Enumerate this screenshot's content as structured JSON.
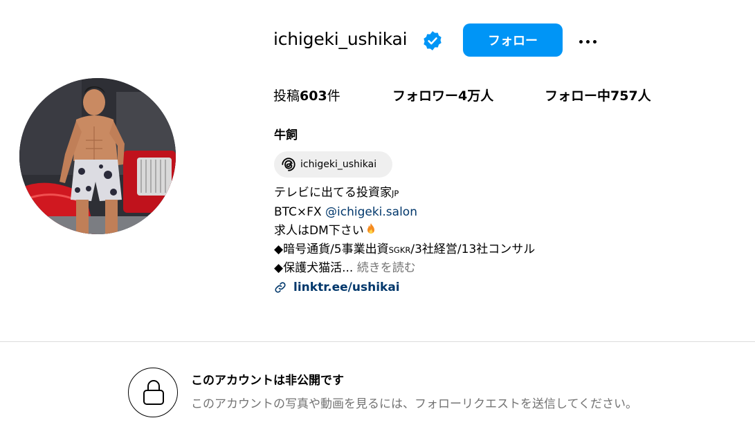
{
  "profile": {
    "username": "ichigeki_ushikai",
    "verified": true,
    "follow_label": "フォロー",
    "full_name": "牛飼",
    "threads_handle": "ichigeki_ushikai"
  },
  "stats": {
    "posts_label": "投稿",
    "posts_count": "603",
    "posts_unit": "件",
    "followers": "フォロワー4万人",
    "following": "フォロー中757人"
  },
  "bio": {
    "line1": "テレビに出てる投資家",
    "line1_suffix": "JP",
    "line2_prefix": "BTC×FX ",
    "line2_mention": "@ichigeki.salon",
    "line3": "求人はDM下さい",
    "line4_prefix": "◆暗号通貨/5事業出資",
    "line4_small": "SGKR",
    "line4_suffix": "/3社経営/13社コンサル",
    "line5": "◆保護犬猫活...",
    "line5_more": "続きを読む"
  },
  "link": {
    "text": "linktr.ee/ushikai"
  },
  "private": {
    "title": "このアカウントは非公開です",
    "description": "このアカウントの写真や動画を見るには、フォローリクエストを送信してください。"
  },
  "colors": {
    "accent": "#0095f6",
    "link": "#00376b",
    "muted": "#737373",
    "verified": "#0095f6"
  },
  "icons": {
    "verified": "verified-badge-icon",
    "more": "more-options-icon",
    "threads": "threads-icon",
    "link": "link-icon",
    "lock": "lock-icon",
    "flame": "fire-emoji-icon"
  }
}
